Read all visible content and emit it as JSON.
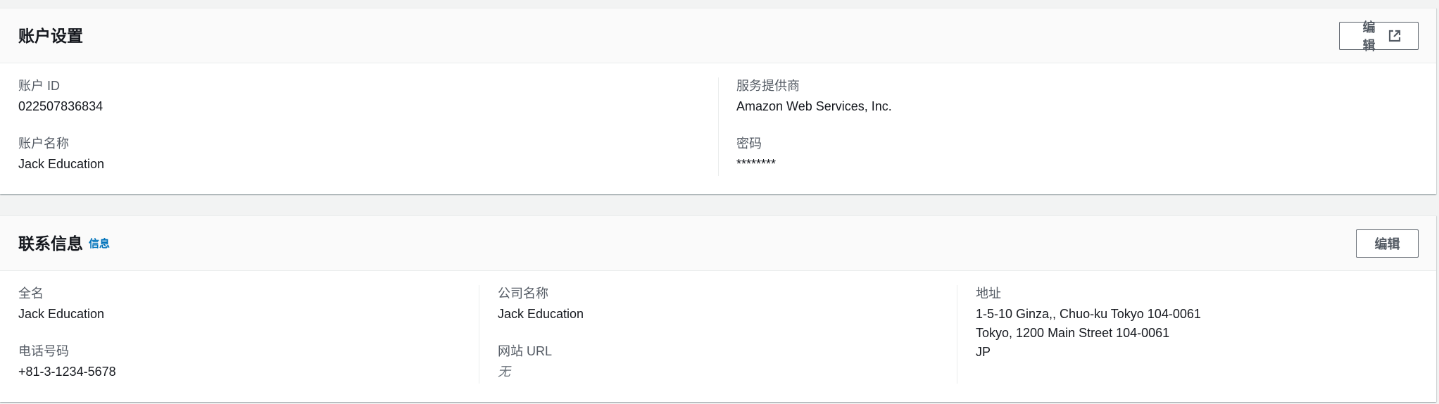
{
  "account_settings": {
    "title": "账户设置",
    "edit_label": "编辑",
    "fields": {
      "account_id": {
        "label": "账户 ID",
        "value": "022507836834"
      },
      "account_name": {
        "label": "账户名称",
        "value": "Jack Education"
      },
      "service_provider": {
        "label": "服务提供商",
        "value": "Amazon Web Services, Inc."
      },
      "password": {
        "label": "密码",
        "value": "********"
      }
    }
  },
  "contact_info": {
    "title": "联系信息",
    "info_link": "信息",
    "edit_label": "编辑",
    "fields": {
      "full_name": {
        "label": "全名",
        "value": "Jack Education"
      },
      "phone": {
        "label": "电话号码",
        "value": "+81-3-1234-5678"
      },
      "company_name": {
        "label": "公司名称",
        "value": "Jack Education"
      },
      "website": {
        "label": "网站 URL",
        "value": "无"
      },
      "address": {
        "label": "地址",
        "lines": [
          "1-5-10 Ginza,, Chuo-ku Tokyo 104-0061",
          "Tokyo, 1200 Main Street 104-0061",
          "JP"
        ]
      }
    }
  },
  "icons": {
    "account_edit_icon": "external-link-icon"
  },
  "colors": {
    "link": "#0073bb",
    "text": "#16191f",
    "label": "#545b64",
    "page_bg": "#f2f3f3"
  }
}
